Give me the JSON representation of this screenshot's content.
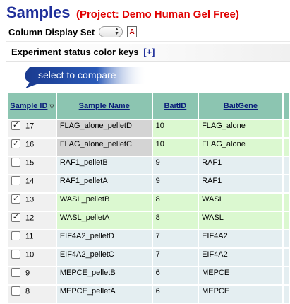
{
  "header": {
    "title": "Samples",
    "project": "(Project: Demo Human Gel Free)"
  },
  "column_display": {
    "label": "Column Display Set"
  },
  "keys": {
    "label": "Experiment status color keys",
    "toggle": "[+]"
  },
  "compare": {
    "label": "select to compare"
  },
  "table": {
    "headers": {
      "sample_id": "Sample ID",
      "sample_name": "Sample Name",
      "bait_id": "BaitID",
      "bait_gene": "BaitGene"
    },
    "rows": [
      {
        "checked": true,
        "id": "17",
        "name": "FLAG_alone_pelletD",
        "bait_id": "10",
        "gene": "FLAG_alone",
        "highlight": true
      },
      {
        "checked": true,
        "id": "16",
        "name": "FLAG_alone_pelletC",
        "bait_id": "10",
        "gene": "FLAG_alone",
        "highlight": true
      },
      {
        "checked": false,
        "id": "15",
        "name": "RAF1_pelletB",
        "bait_id": "9",
        "gene": "RAF1",
        "highlight": false
      },
      {
        "checked": false,
        "id": "14",
        "name": "RAF1_pelletA",
        "bait_id": "9",
        "gene": "RAF1",
        "highlight": false
      },
      {
        "checked": true,
        "id": "13",
        "name": "WASL_pelletB",
        "bait_id": "8",
        "gene": "WASL",
        "highlight": false
      },
      {
        "checked": true,
        "id": "12",
        "name": "WASL_pelletA",
        "bait_id": "8",
        "gene": "WASL",
        "highlight": false
      },
      {
        "checked": false,
        "id": "11",
        "name": "EIF4A2_pelletD",
        "bait_id": "7",
        "gene": "EIF4A2",
        "highlight": false
      },
      {
        "checked": false,
        "id": "10",
        "name": "EIF4A2_pelletC",
        "bait_id": "7",
        "gene": "EIF4A2",
        "highlight": false
      },
      {
        "checked": false,
        "id": "9",
        "name": "MEPCE_pelletB",
        "bait_id": "6",
        "gene": "MEPCE",
        "highlight": false
      },
      {
        "checked": false,
        "id": "8",
        "name": "MEPCE_pelletA",
        "bait_id": "6",
        "gene": "MEPCE",
        "highlight": false
      }
    ]
  }
}
